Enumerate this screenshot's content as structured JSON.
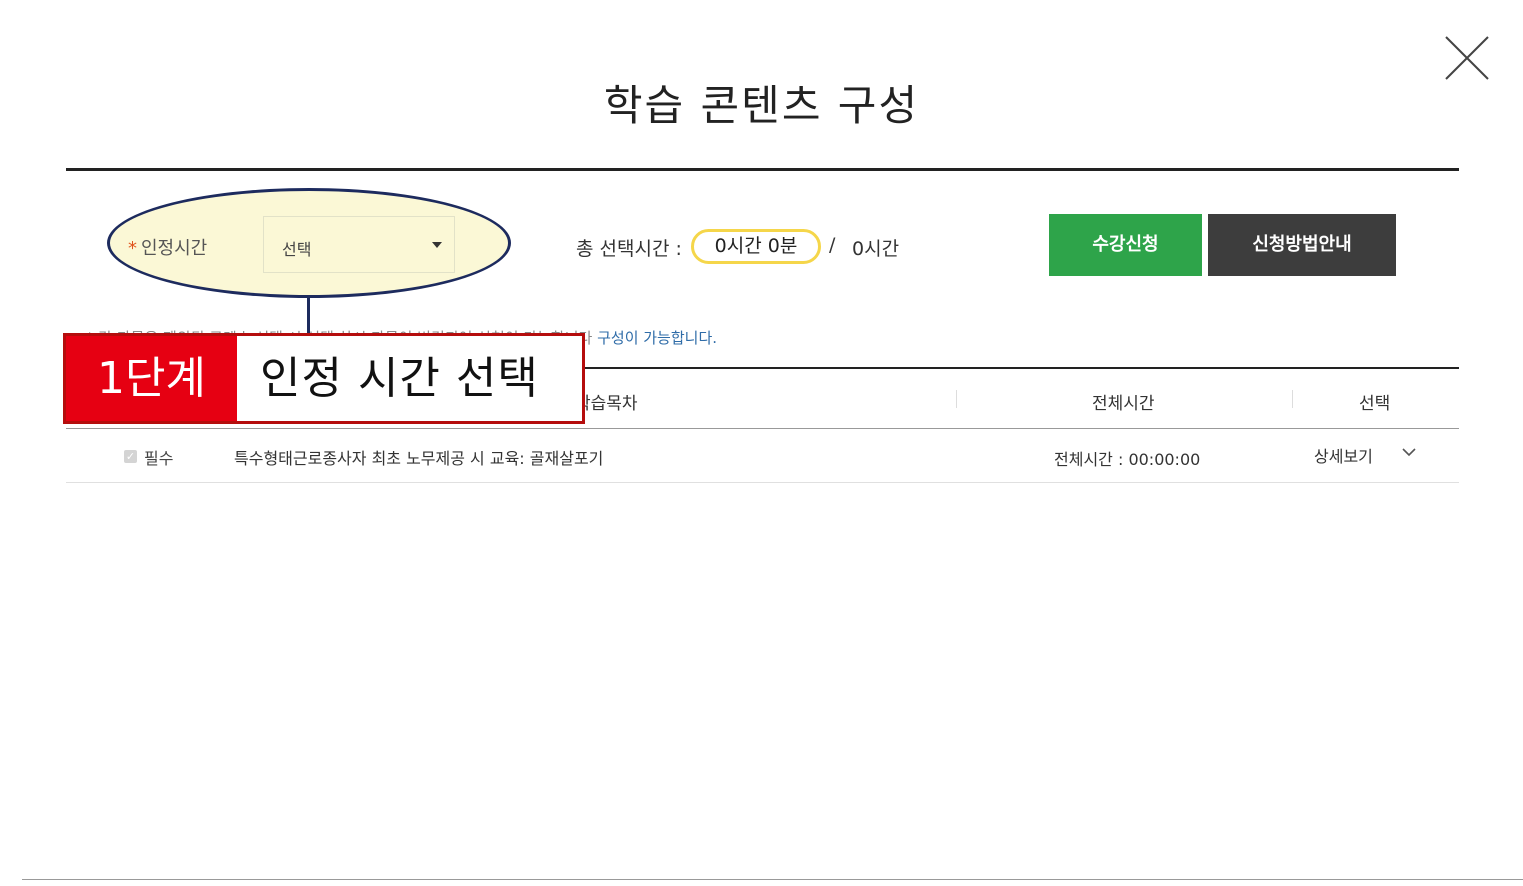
{
  "dialog": {
    "title": "학습 콘텐츠 구성"
  },
  "filter": {
    "required_mark": "*",
    "label": "인정시간",
    "select_value": "선택"
  },
  "summary": {
    "label": "총 선택시간 :",
    "selected_time": "0시간 0분",
    "separator": "/",
    "max_time": "0시간"
  },
  "buttons": {
    "apply": "수강신청",
    "guide": "신청방법안내"
  },
  "note": {
    "text_gray": "* 각 과목은 제외된 콘텐츠 선택 시 선택 차시 과목이 변경되어 신청이 가능합니다 ",
    "text_blue": "구성이 가능합니다."
  },
  "table": {
    "columns": [
      "학습목차",
      "전체시간",
      "선택"
    ],
    "rows": [
      {
        "required": "필수",
        "title": "특수형태근로종사자 최초 노무제공 시 교육: 골재살포기",
        "duration": "전체시간 : 00:00:00",
        "detail": "상세보기"
      }
    ]
  },
  "callout": {
    "step": "1단계",
    "text": "인정 시간 선택"
  },
  "colors": {
    "apply_button": "#2ea44a",
    "guide_button": "#3d3d3d",
    "highlight_fill": "#fbf8d6",
    "ellipse_border": "#1d2b5e",
    "step_red": "#e60012",
    "pill_border": "#f5d64a"
  },
  "icons": {
    "close": "close-icon",
    "select_caret": "caret-down-icon",
    "row_expand": "chevron-down-icon"
  }
}
